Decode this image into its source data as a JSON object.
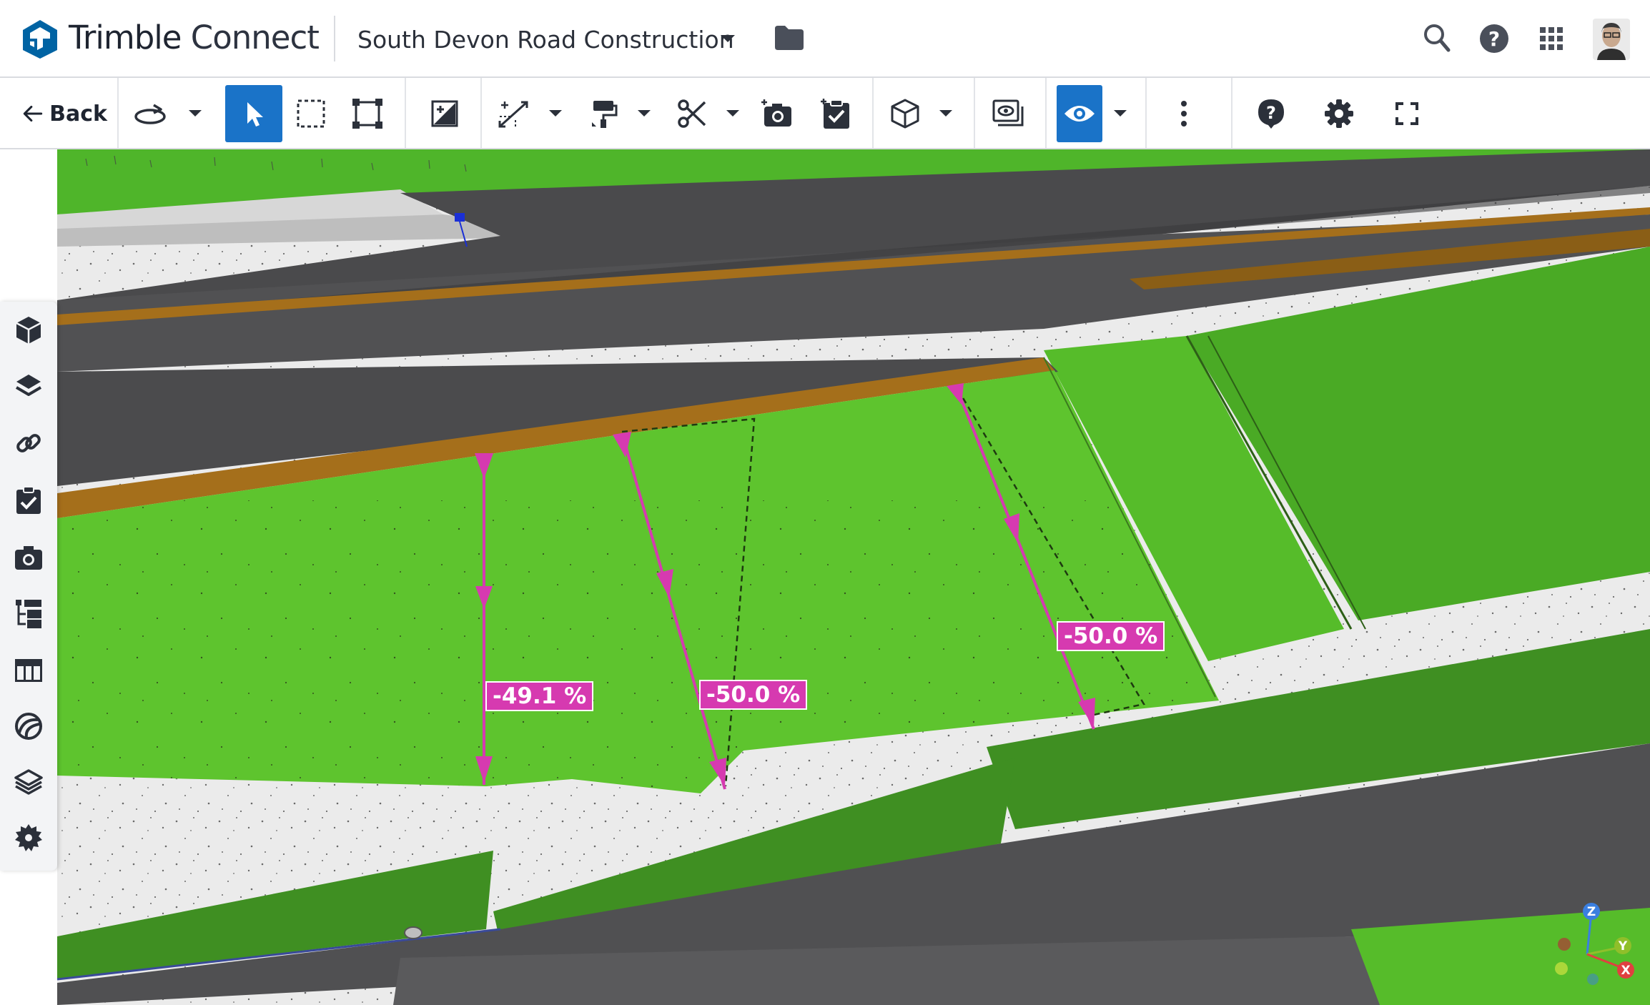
{
  "app": {
    "brand_part1": "Trimble",
    "brand_part2": " Connect",
    "logo_icon": "trimble-logo-icon"
  },
  "header": {
    "project_name": "South Devon Road Construction",
    "icons": [
      "chevron-down-icon",
      "folder-icon",
      "search-icon",
      "help-icon",
      "apps-grid-icon",
      "avatar"
    ]
  },
  "toolbar": {
    "back_label": "Back",
    "tools": [
      "orbit-icon",
      "select-icon",
      "box-select-icon",
      "fit-view-icon",
      "section-plane-icon",
      "measure-icon",
      "paint-icon",
      "cut-icon",
      "snapshot-icon",
      "todo-icon",
      "view-cube-icon",
      "model-view-icon",
      "visibility-icon",
      "more-icon",
      "help-icon",
      "settings-icon",
      "fullscreen-icon"
    ],
    "active_tools": [
      "select-icon",
      "visibility-icon"
    ],
    "accent_color": "#1a73c8"
  },
  "side_panel": {
    "items": [
      "models-icon",
      "layers-icon",
      "links-icon",
      "todos-icon",
      "views-icon",
      "hierarchy-icon",
      "table-icon",
      "3d-objects-icon",
      "stack-icon",
      "settings-gear-icon"
    ]
  },
  "measurements": [
    {
      "label": "-49.1 %"
    },
    {
      "label": "-50.0 %"
    },
    {
      "label": "-50.0 %"
    }
  ],
  "axis_gizmo": {
    "z": "Z",
    "y": "Y",
    "x": "X"
  },
  "colors": {
    "slope_marker": "#d63ab0",
    "terrain_green": "#5ec42e",
    "road_gray": "#4a4a4c",
    "embankment_brown": "#a56f1b"
  }
}
